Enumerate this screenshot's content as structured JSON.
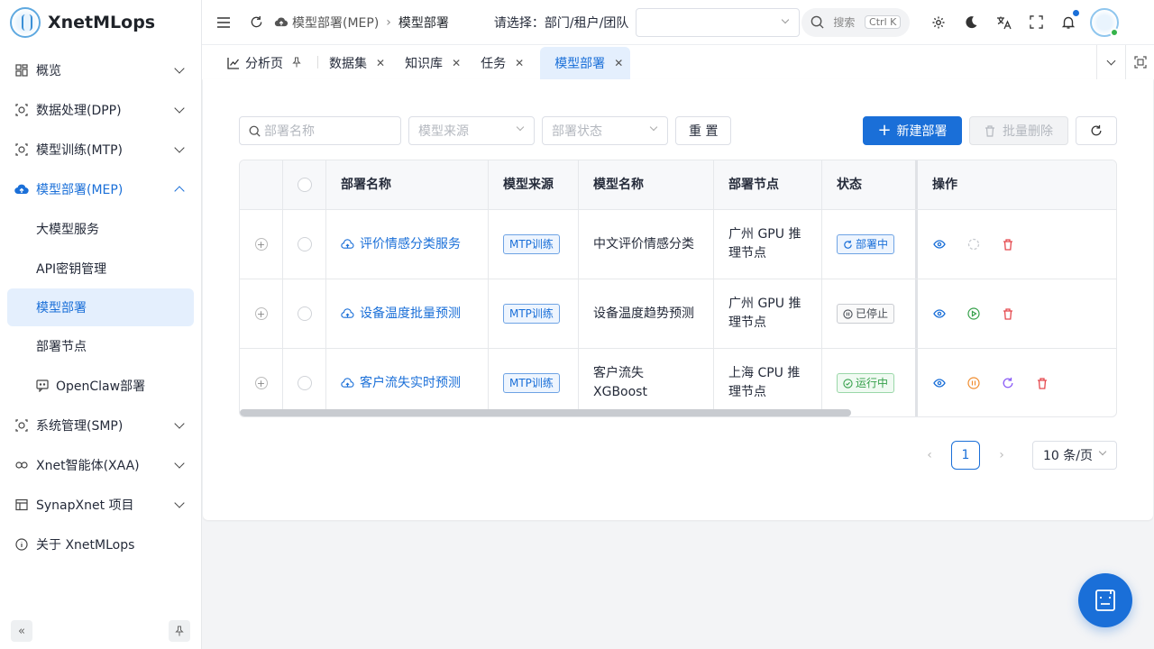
{
  "app": {
    "name": "XnetMLops"
  },
  "sidebar": {
    "items": [
      {
        "label": "概览",
        "icon": "dashboard-icon",
        "expanded": false
      },
      {
        "label": "数据处理(DPP)",
        "icon": "module-icon",
        "expanded": false
      },
      {
        "label": "模型训练(MTP)",
        "icon": "module-icon",
        "expanded": false
      },
      {
        "label": "模型部署(MEP)",
        "icon": "cloud-upload-icon",
        "expanded": true,
        "children": [
          {
            "label": "大模型服务"
          },
          {
            "label": "API密钥管理"
          },
          {
            "label": "模型部署",
            "active": true
          },
          {
            "label": "部署节点"
          },
          {
            "label": "OpenClaw部署",
            "icon": "chat-icon"
          }
        ]
      },
      {
        "label": "系统管理(SMP)",
        "icon": "module-icon",
        "expanded": false
      },
      {
        "label": "Xnet智能体(XAA)",
        "icon": "agent-icon",
        "expanded": false
      },
      {
        "label": "SynapXnet 项目",
        "icon": "table-icon",
        "expanded": false
      },
      {
        "label": "关于 XnetMLops",
        "icon": "info-icon"
      }
    ]
  },
  "header": {
    "breadcrumb": [
      "模型部署(MEP)",
      "模型部署"
    ],
    "selector_label": "请选择：部门/租户/团队",
    "search_placeholder": "搜索",
    "search_shortcut": "Ctrl K"
  },
  "tabs": [
    {
      "label": "分析页",
      "icon": "chart-icon",
      "pinned": true
    },
    {
      "label": "数据集"
    },
    {
      "label": "知识库"
    },
    {
      "label": "任务"
    },
    {
      "label": "模型部署",
      "active": true
    }
  ],
  "toolbar": {
    "name_placeholder": "部署名称",
    "source_placeholder": "模型来源",
    "status_placeholder": "部署状态",
    "reset_label": "重 置",
    "create_label": "新建部署",
    "batch_delete_label": "批量删除"
  },
  "table": {
    "columns": [
      "部署名称",
      "模型来源",
      "模型名称",
      "部署节点",
      "状态",
      "操作"
    ],
    "rows": [
      {
        "name": "评价情感分类服务",
        "source": "MTP训练",
        "model": "中文评价情感分类",
        "node": "广州 GPU 推理节点",
        "status": "部署中",
        "status_color": "#1a6fd8"
      },
      {
        "name": "设备温度批量预测",
        "source": "MTP训练",
        "model": "设备温度趋势预测",
        "node": "广州 GPU 推理节点",
        "status": "已停止",
        "status_color": "#4a4f57"
      },
      {
        "name": "客户流失实时预测",
        "source": "MTP训练",
        "model": "客户流失 XGBoost",
        "node": "上海 CPU 推理节点",
        "status": "运行中",
        "status_color": "#35a04a"
      }
    ]
  },
  "pagination": {
    "current_page": "1",
    "page_size": "10 条/页"
  },
  "colors": {
    "primary": "#1a6fd8",
    "danger": "#e5484d",
    "success": "#35a04a",
    "warning": "#f08c2e",
    "purple": "#8b5cf6"
  }
}
